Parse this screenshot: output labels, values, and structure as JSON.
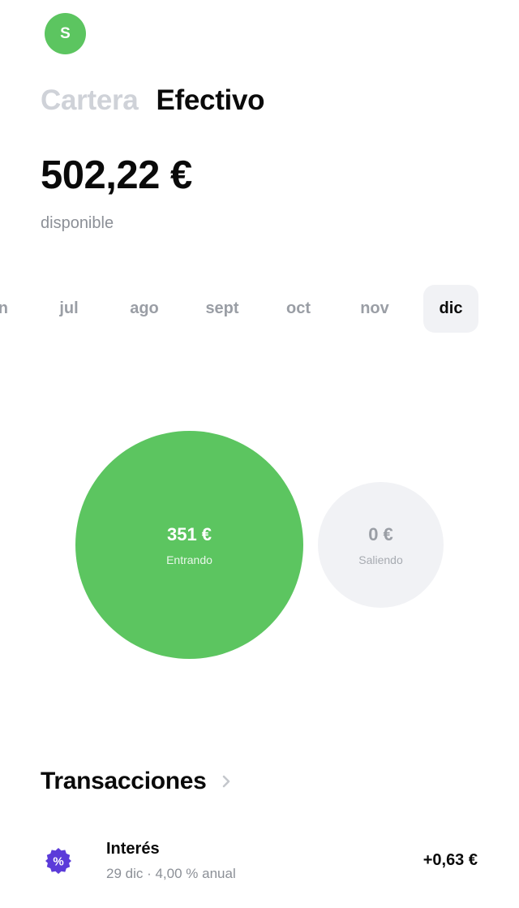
{
  "user": {
    "avatar_initial": "S"
  },
  "tabs": [
    {
      "label": "Cartera",
      "active": false
    },
    {
      "label": "Efectivo",
      "active": true
    }
  ],
  "balance": {
    "amount": "502,22 €",
    "label": "disponible"
  },
  "months": [
    {
      "label": "n",
      "selected": false
    },
    {
      "label": "jul",
      "selected": false
    },
    {
      "label": "ago",
      "selected": false
    },
    {
      "label": "sept",
      "selected": false
    },
    {
      "label": "oct",
      "selected": false
    },
    {
      "label": "nov",
      "selected": false
    },
    {
      "label": "dic",
      "selected": true
    }
  ],
  "cashflow": {
    "incoming": {
      "amount": "351 €",
      "label": "Entrando"
    },
    "outgoing": {
      "amount": "0 €",
      "label": "Saliendo"
    }
  },
  "transactions": {
    "title": "Transacciones",
    "items": [
      {
        "icon": "percent-badge-icon",
        "title": "Interés",
        "subtitle": "29 dic · 4,00 % anual",
        "amount": "+0,63 €"
      }
    ]
  },
  "colors": {
    "accent_green": "#5cc560",
    "interest_purple": "#5b3bd9",
    "muted_gray": "#9a9ea5",
    "selected_chip_bg": "#f1f2f5"
  }
}
